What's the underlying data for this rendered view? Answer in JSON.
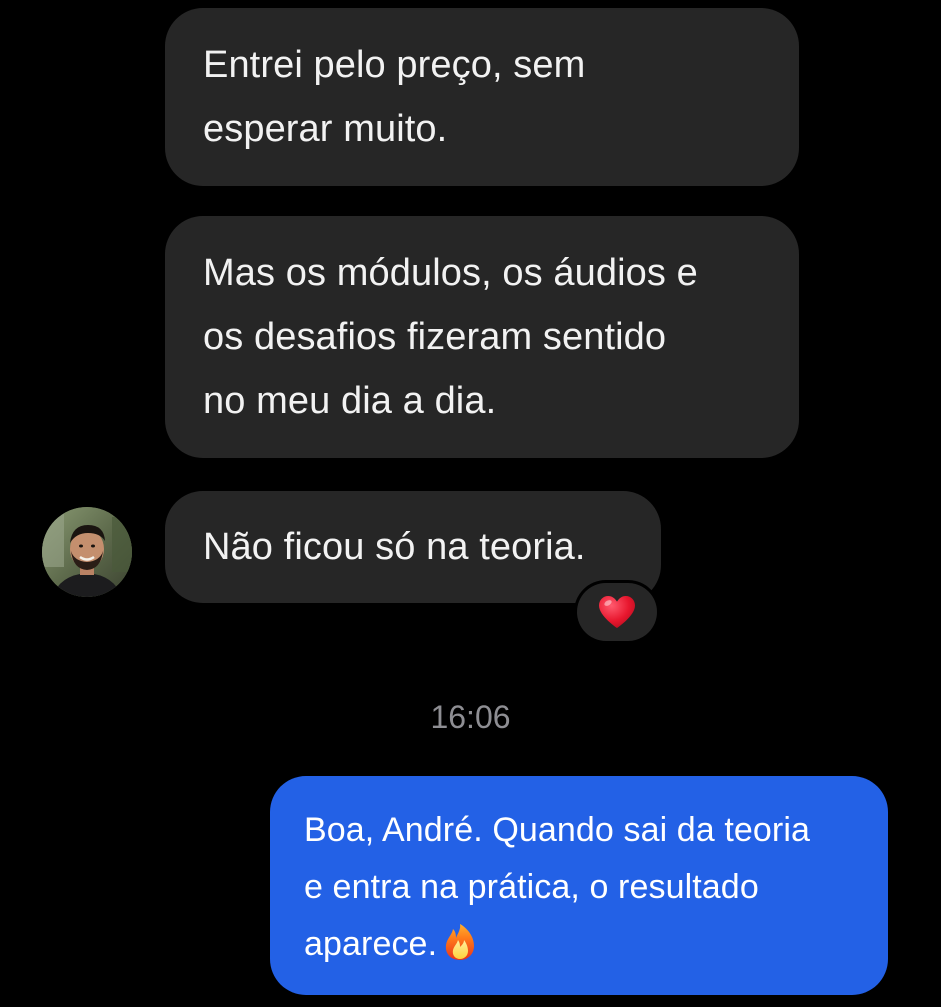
{
  "colors": {
    "background": "#000000",
    "incoming_bubble": "#262626",
    "outgoing_bubble": "#2361e6",
    "timestamp_text": "#8e8e93"
  },
  "messages": [
    {
      "direction": "incoming",
      "lines": [
        "Entrei pelo preço, sem",
        "esperar muito."
      ]
    },
    {
      "direction": "incoming",
      "lines": [
        "Mas os módulos, os áudios e",
        "os desafios fizeram sentido",
        "no meu dia a dia."
      ]
    },
    {
      "direction": "incoming",
      "lines": [
        "Não ficou só na teoria."
      ],
      "reaction": "heart-emoji"
    }
  ],
  "timestamp": "16:06",
  "reply": {
    "direction": "outgoing",
    "lines": [
      "Boa, André. Quando sai da teoria",
      "e entra na prática, o resultado",
      "aparece."
    ],
    "trailing_emoji": "fire-emoji"
  },
  "sender_avatar": "profile-photo"
}
